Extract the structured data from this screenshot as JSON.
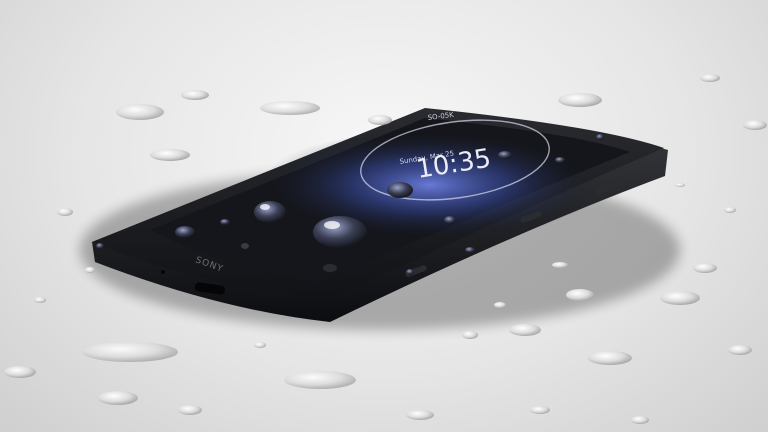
{
  "photo": {
    "subject": "smartphone",
    "screen": {
      "top_text": "SO-05K",
      "date": "Sunday, Mar 25",
      "time": "10:35"
    },
    "brand_mark": "SONY",
    "colors": {
      "surface": "#e8e8e8",
      "phone_body": "#1b1c1f",
      "screen_glow": "#3a4fa8"
    }
  }
}
